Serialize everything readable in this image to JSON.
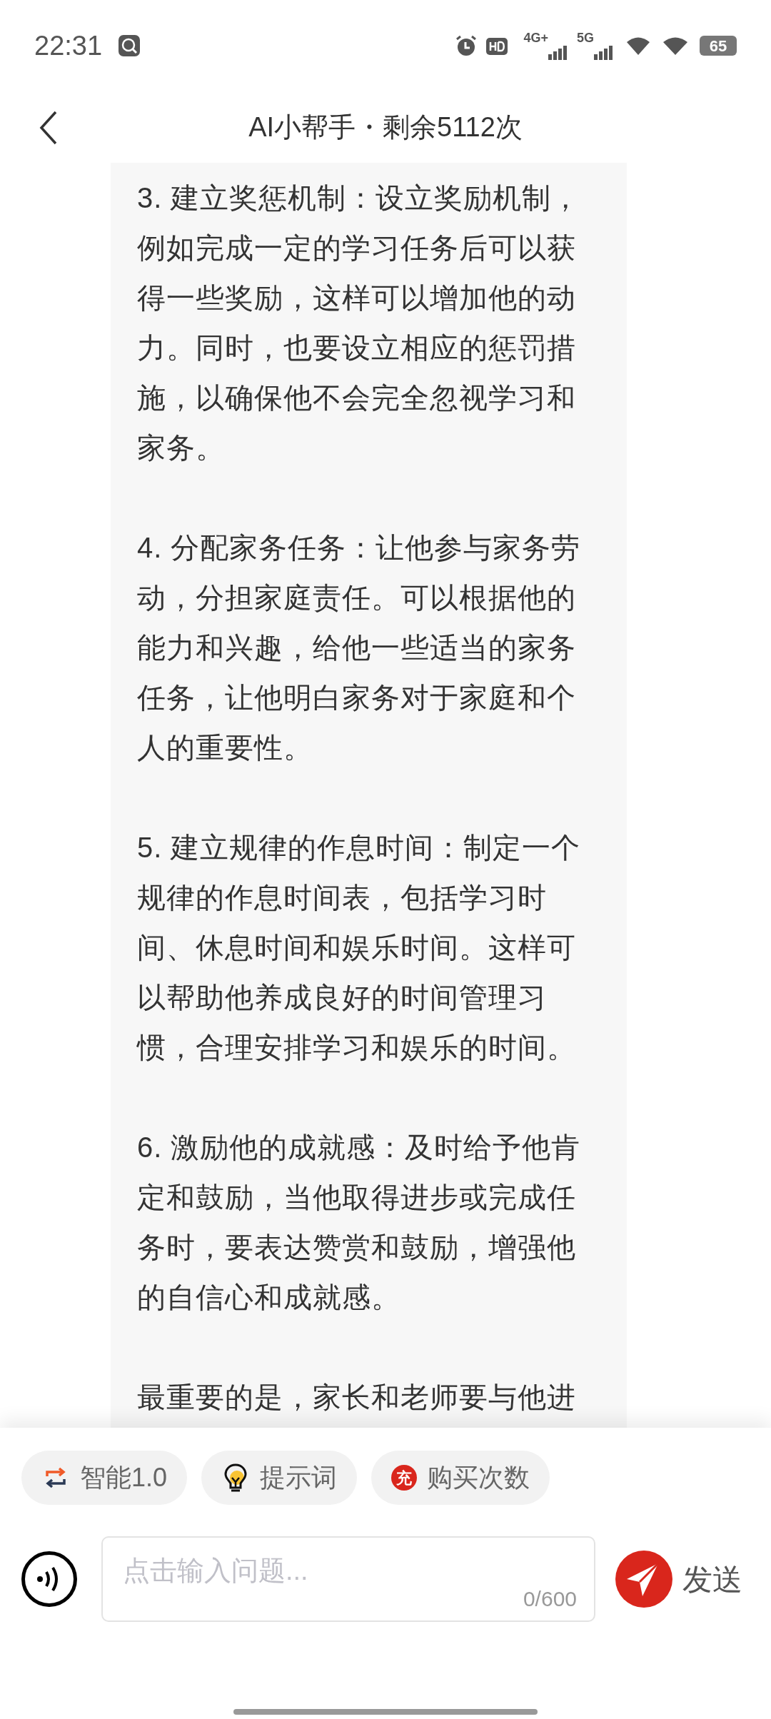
{
  "status_bar": {
    "time": "22:31",
    "battery": "65",
    "network_1": "4G+",
    "network_2": "5G"
  },
  "header": {
    "title": "AI小帮手・剩余5112次"
  },
  "message": {
    "paragraphs": [
      "3. 建立奖惩机制：设立奖励机制，例如完成一定的学习任务后可以获得一些奖励，这样可以增加他的动力。同时，也要设立相应的惩罚措施，以确保他不会完全忽视学习和家务。",
      "4. 分配家务任务：让他参与家务劳动，分担家庭责任。可以根据他的能力和兴趣，给他一些适当的家务任务，让他明白家务对于家庭和个人的重要性。",
      "5. 建立规律的作息时间：制定一个规律的作息时间表，包括学习时间、休息时间和娱乐时间。这样可以帮助他养成良好的时间管理习惯，合理安排学习和娱乐的时间。",
      "6. 激励他的成就感：及时给予他肯定和鼓励，当他取得进步或完成任务时，要表达赞赏和鼓励，增强他的自信心和成就感。",
      "最重要的是，家长和老师要与他进"
    ]
  },
  "chips": [
    {
      "kind": "mode",
      "label": "智能1.0"
    },
    {
      "kind": "prompt",
      "label": "提示词"
    },
    {
      "kind": "buy",
      "label": "购买次数",
      "badge": "充"
    }
  ],
  "input": {
    "placeholder": "点击输入问题...",
    "counter": "0/600"
  },
  "send_button": {
    "label": "发送"
  }
}
